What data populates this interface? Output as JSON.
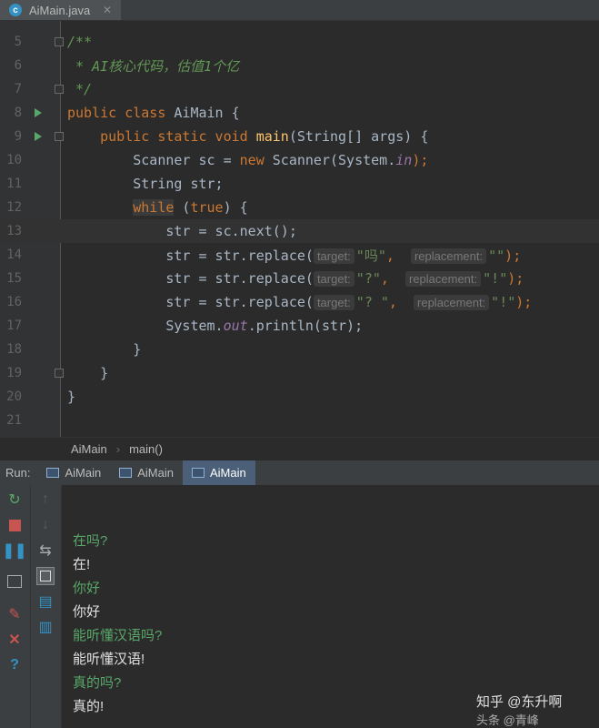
{
  "tab": {
    "filename": "AiMain.java",
    "icon_letter": "c",
    "close": "✕"
  },
  "editor": {
    "line_numbers": [
      "5",
      "6",
      "7",
      "8",
      "9",
      "10",
      "11",
      "12",
      "13",
      "14",
      "15",
      "16",
      "17",
      "18",
      "19",
      "20",
      "21"
    ],
    "lines": {
      "l5": "/**",
      "l6": " * AI核心代码，估值1个亿",
      "l7": " */",
      "l8_kw": "public class ",
      "l8_rest": "AiMain {",
      "l9_kw": "    public static void ",
      "l9_fn": "main",
      "l9_rest": "(String[] args) {",
      "l10_a": "        Scanner sc = ",
      "l10_kw": "new ",
      "l10_b": "Scanner(System.",
      "l10_fld": "in",
      "l10_c": ");",
      "l11": "        String str;",
      "l12_pre": "        ",
      "l12_kw": "while",
      "l12_mid": " (",
      "l12_kw2": "true",
      "l12_rest": ") {",
      "l13": "            str = sc.next();",
      "l14_a": "            str = str.replace(",
      "l14_h1": "target:",
      "l14_s1": "\"吗\"",
      "l14_comma": ",  ",
      "l14_h2": "replacement:",
      "l14_s2": "\"\"",
      "l14_end": ");",
      "l15_a": "            str = str.replace(",
      "l15_h1": "target:",
      "l15_s1": "\"?\"",
      "l15_comma": ",  ",
      "l15_h2": "replacement:",
      "l15_s2": "\"!\"",
      "l15_end": ");",
      "l16_a": "            str = str.replace(",
      "l16_h1": "target:",
      "l16_s1": "\"? \"",
      "l16_comma": ",  ",
      "l16_h2": "replacement:",
      "l16_s2": "\"!\"",
      "l16_end": ");",
      "l17_a": "            System.",
      "l17_fld": "out",
      "l17_b": ".println(str);",
      "l18": "        }",
      "l19": "    }",
      "l20": "}",
      "l21": ""
    }
  },
  "breadcrumb": {
    "class": "AiMain",
    "sep": "›",
    "method": "main()"
  },
  "run": {
    "label": "Run:",
    "tabs": [
      "AiMain",
      "AiMain",
      "AiMain"
    ],
    "active_index": 2
  },
  "console": {
    "lines": [
      {
        "text": "在吗?",
        "kind": "input"
      },
      {
        "text": "在!",
        "kind": "output"
      },
      {
        "text": "你好",
        "kind": "input"
      },
      {
        "text": "你好",
        "kind": "output"
      },
      {
        "text": "能听懂汉语吗?",
        "kind": "input"
      },
      {
        "text": "能听懂汉语!",
        "kind": "output"
      },
      {
        "text": "真的吗?",
        "kind": "input"
      },
      {
        "text": "真的!",
        "kind": "output"
      }
    ]
  },
  "watermark": {
    "text": "知乎 @东升啊",
    "sub": "头条 @青峰"
  },
  "colors": {
    "background": "#2b2b2b",
    "keyword": "#cc7832",
    "comment": "#629755",
    "string": "#6a8759",
    "function": "#ffc66d",
    "field": "#9876aa",
    "console_input": "#59a869"
  }
}
